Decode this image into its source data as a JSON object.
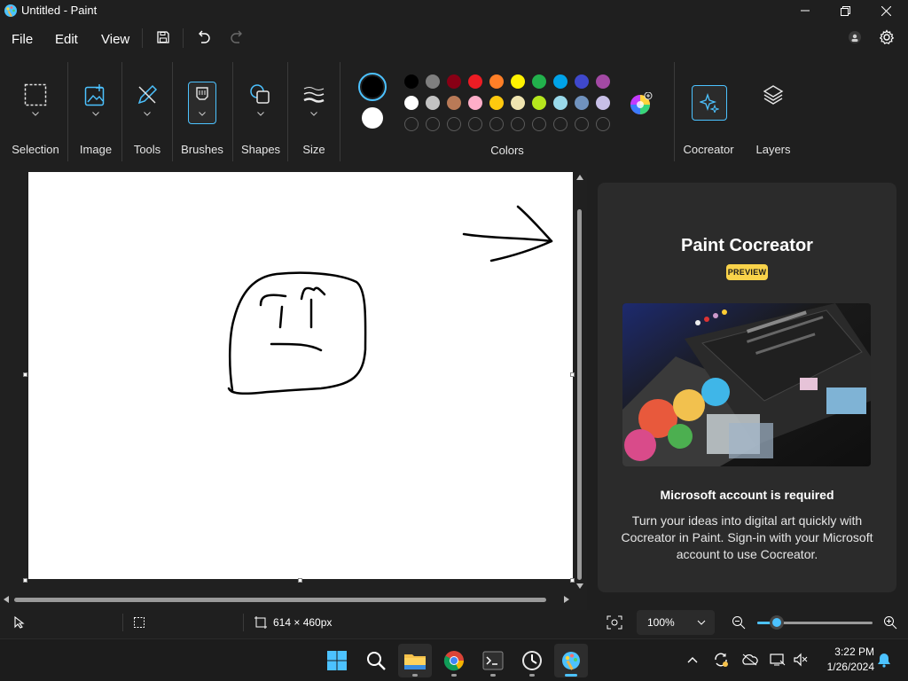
{
  "window": {
    "title": "Untitled - Paint"
  },
  "menu": {
    "file": "File",
    "edit": "Edit",
    "view": "View"
  },
  "ribbon": {
    "selection": "Selection",
    "image": "Image",
    "tools": "Tools",
    "brushes": "Brushes",
    "shapes": "Shapes",
    "size": "Size",
    "colors": "Colors",
    "cocreator": "Cocreator",
    "layers": "Layers"
  },
  "colors": {
    "primary": "#000000",
    "secondary": "#ffffff",
    "palette_row1": [
      "#000000",
      "#7f7f7f",
      "#880015",
      "#ed1c24",
      "#ff7f27",
      "#fff200",
      "#22b14c",
      "#00a2e8",
      "#3f48cc",
      "#a349a4"
    ],
    "palette_row2": [
      "#ffffff",
      "#c3c3c3",
      "#b97a57",
      "#ffaec9",
      "#ffc90e",
      "#efe4b0",
      "#b5e61d",
      "#99d9ea",
      "#7092be",
      "#c8bfe7"
    ],
    "custom_slots": 10
  },
  "cocreator_panel": {
    "title": "Paint Cocreator",
    "badge": "PREVIEW",
    "account_required": "Microsoft account is required",
    "description": "Turn your ideas into digital art quickly with Cocreator in Paint. Sign-in with your Microsoft account to use Cocreator."
  },
  "status": {
    "canvas_size": "614 × 460px",
    "zoom": "100%",
    "zoom_level_percent": 100
  },
  "taskbar": {
    "time": "3:22 PM",
    "date": "1/26/2024"
  }
}
